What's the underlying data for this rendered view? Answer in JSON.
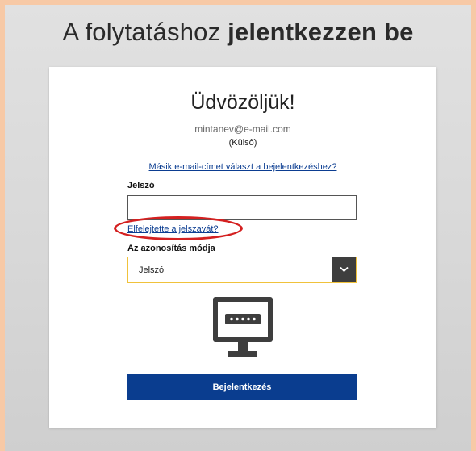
{
  "header": {
    "title_prefix": "A folytatáshoz",
    "title_bold": "jelentkezzen be"
  },
  "card": {
    "welcome": "Üdvözöljük!",
    "email": "mintanev@e-mail.com",
    "account_type": "(Külső)",
    "other_email_link": "Másik e-mail-címet választ a bejelentkezéshez?",
    "password_label": "Jelszó",
    "password_value": "",
    "forgot_password_link": "Elfelejtette a jelszavát?",
    "auth_method_label": "Az azonosítás módja",
    "auth_method_selected": "Jelszó",
    "login_button": "Bejelentkezés"
  },
  "icons": {
    "dropdown": "chevron-down-icon",
    "monitor": "password-monitor-icon"
  },
  "colors": {
    "primary_button": "#0a3d8f",
    "link": "#0b3d91",
    "select_border": "#f0c23b",
    "highlight_ellipse": "#d42020"
  }
}
